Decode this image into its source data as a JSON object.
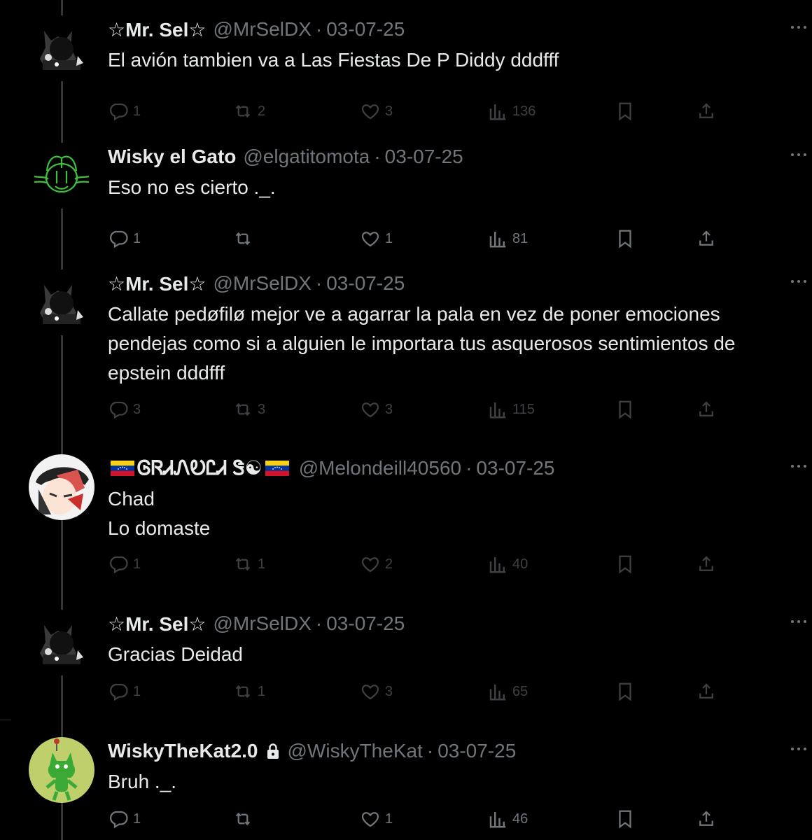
{
  "colors": {
    "background": "#000000",
    "text_primary": "#e7e9ea",
    "text_secondary": "#71767b",
    "thread_line": "#333639"
  },
  "tweets": [
    {
      "name": "☆Mr. Sel☆",
      "handle": "@MrSelDX",
      "separator": "·",
      "date": "03-07-25",
      "avatar_icon": "black-cat-avatar",
      "lines": [
        "El avión tambien va a Las Fiestas De P Diddy dddfff"
      ],
      "replies": "1",
      "retweets": "2",
      "likes": "3",
      "views": "136",
      "dimmed": true
    },
    {
      "name": "Wisky el Gato",
      "handle": "@elgatitomota",
      "separator": "·",
      "date": "03-07-25",
      "avatar_icon": "green-cat-outline-avatar",
      "lines": [
        "Eso no es cierto ._."
      ],
      "replies": "1",
      "retweets": "",
      "likes": "1",
      "views": "81",
      "dimmed": false
    },
    {
      "name": "☆Mr. Sel☆",
      "handle": "@MrSelDX",
      "separator": "·",
      "date": "03-07-25",
      "avatar_icon": "black-cat-avatar",
      "lines": [
        "Callate pedøfilø mejor ve a agarrar la pala en vez de poner emociones",
        "pendejas como si a alguien le importara tus asquerosos sentimientos de",
        "epstein dddfff"
      ],
      "replies": "3",
      "retweets": "3",
      "likes": "3",
      "views": "115",
      "dimmed": true
    },
    {
      "name": "ᎶᏒᏗᏁᎧᏝᏗ Ꮥ☯",
      "handle": "@Melondeill40560",
      "separator": "·",
      "date": "03-07-25",
      "avatar_icon": "anime-character-avatar",
      "lines": [
        "Chad",
        "Lo domaste"
      ],
      "replies": "1",
      "retweets": "1",
      "likes": "2",
      "views": "40",
      "dimmed": true
    },
    {
      "name": "☆Mr. Sel☆",
      "handle": "@MrSelDX",
      "separator": "·",
      "date": "03-07-25",
      "avatar_icon": "black-cat-avatar",
      "lines": [
        "Gracias Deidad"
      ],
      "replies": "1",
      "retweets": "1",
      "likes": "3",
      "views": "65",
      "dimmed": true
    },
    {
      "name": "WiskyTheKat2.0",
      "handle": "@WiskyTheKat",
      "separator": "·",
      "date": "03-07-25",
      "avatar_icon": "green-cartoon-cat-avatar",
      "lines": [
        "Bruh ._."
      ],
      "replies": "1",
      "retweets": "",
      "likes": "1",
      "views": "46",
      "dimmed": false
    }
  ]
}
